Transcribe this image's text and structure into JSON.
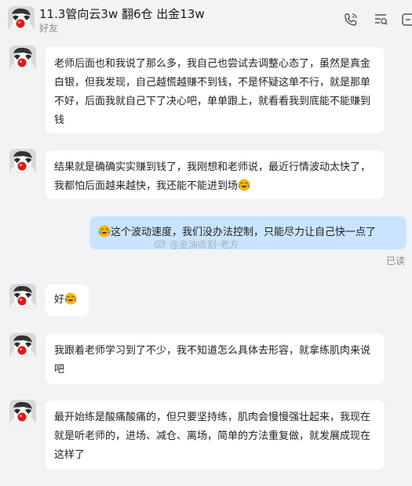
{
  "header": {
    "title": "11.3管向云3w 翻6仓 出金13w",
    "subtitle": "好友",
    "icons": [
      "phone-icon",
      "notes-icon",
      "search-icon",
      "more-icon"
    ]
  },
  "messages": [
    {
      "from": "peer",
      "text": "老师后面也和我说了那么多，我自己也尝试去调整心态了，虽然是真金白银，但我发现，自己越慌越赚不到钱，不是怀疑这单不行，就是那单不好，后面我就自己下了决心吧，单单跟上，就看看我到底能不能赚到钱"
    },
    {
      "from": "peer",
      "text": "结果就是确确实实赚到钱了，我刚想和老师说，最近行情波动太快了，我都怕后面越来越快，我还能不能进到场",
      "emoji_after": "laugh-cry"
    },
    {
      "from": "self",
      "text": "这个波动速度，我们没办法控制，只能尽力让自己快一点了",
      "emoji_before": "laugh-cry",
      "status": "已读"
    },
    {
      "from": "peer",
      "text": "好",
      "emoji_after": "laugh-cry"
    },
    {
      "from": "peer",
      "text": "我跟着老师学习到了不少，我不知道怎么具体去形容，就拿练肌肉来说吧"
    },
    {
      "from": "peer",
      "text": "最开始练是酸痛酸痛的，但只要坚持练，肌肉会慢慢强壮起来，我现在就是听老师的，进场、减仓、离场，简单的方法重复做，就发展成现在这样了"
    }
  ],
  "watermark": "@金油收割-老方",
  "colors": {
    "background": "#f2f3f5",
    "peer_bubble": "#ffffff",
    "self_bubble": "#c9e4ff"
  }
}
